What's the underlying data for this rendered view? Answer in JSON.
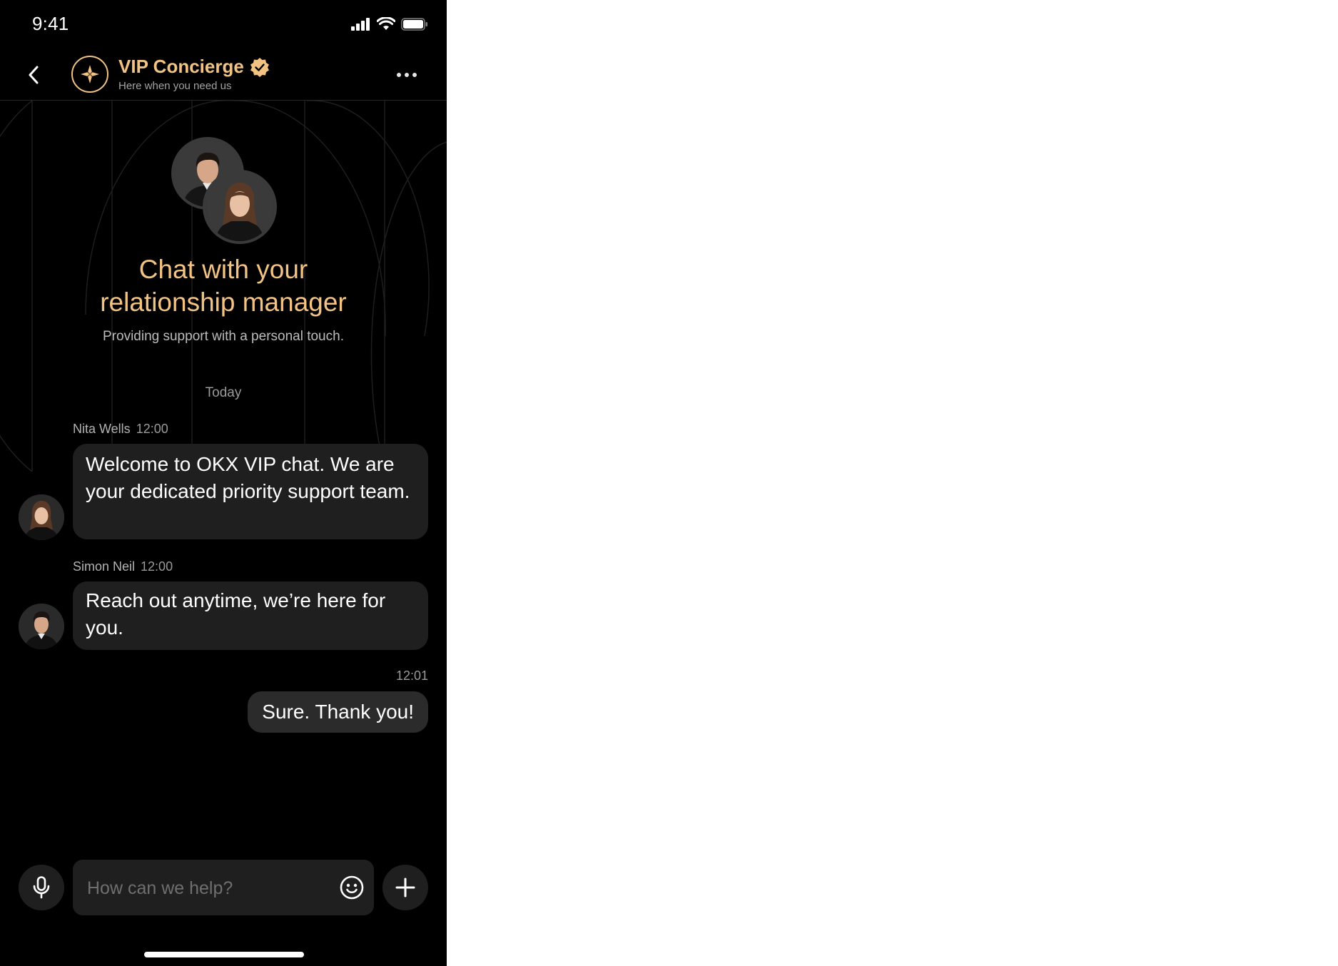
{
  "status_bar": {
    "time": "9:41"
  },
  "header": {
    "title": "VIP Concierge",
    "subtitle": "Here when you need us"
  },
  "hero": {
    "title_line1": "Chat with your",
    "title_line2": "relationship manager",
    "subtitle": "Providing support with a personal touch."
  },
  "date_separator": "Today",
  "messages": [
    {
      "sender": "Nita Wells",
      "time": "12:00",
      "text": "Welcome to OKX VIP chat. We are your dedicated priority support team."
    },
    {
      "sender": "Simon Neil",
      "time": "12:00",
      "text": "Reach out anytime, we’re here for you."
    }
  ],
  "outgoing": {
    "time": "12:01",
    "text": "Sure. Thank you!"
  },
  "composer": {
    "placeholder": "How can we help?"
  },
  "colors": {
    "accent": "#f2c383",
    "background": "#000000",
    "bubble": "#1f1f1f"
  }
}
